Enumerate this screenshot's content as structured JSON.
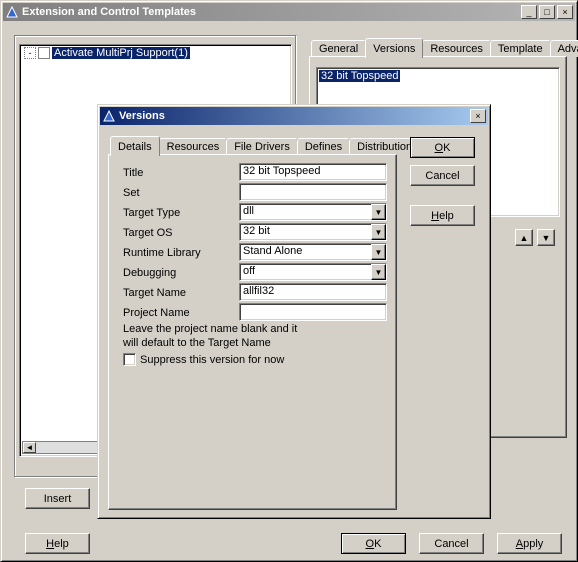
{
  "main_window": {
    "title": "Extension and Control Templates",
    "tree_item": "Activate MultiPrj Support(1)",
    "tabs": [
      "General",
      "Versions",
      "Resources",
      "Template",
      "Advanced"
    ],
    "active_tab": "Versions",
    "list_item": "32 bit Topspeed",
    "buttons": {
      "insert": "Insert",
      "help_letter": "H",
      "help_rest": "elp",
      "ok_letter": "O",
      "ok_rest": "K",
      "cancel": "Cancel",
      "apply_letter": "A",
      "apply_rest": "pply"
    }
  },
  "dialog": {
    "title": "Versions",
    "tabs": [
      "Details",
      "Resources",
      "File Drivers",
      "Defines",
      "Distribution"
    ],
    "active_tab": "Details",
    "fields": {
      "title_label": "Title",
      "title_value": "32 bit Topspeed",
      "set_label": "Set",
      "set_value": "",
      "target_type_label": "Target Type",
      "target_type_value": "dll",
      "target_os_label": "Target OS",
      "target_os_value": "32 bit",
      "runtime_label": "Runtime Library",
      "runtime_value": "Stand Alone",
      "debugging_label": "Debugging",
      "debugging_value": "off",
      "target_name_label": "Target Name",
      "target_name_value": "allfil32",
      "project_name_label": "Project Name",
      "project_name_value": ""
    },
    "hint1": "Leave the project name blank and it",
    "hint2": "will default to the Target Name",
    "checkbox_label": "Suppress this version for now",
    "buttons": {
      "ok_letter": "O",
      "ok_rest": "K",
      "cancel": "Cancel",
      "help_letter": "H",
      "help_rest": "elp"
    }
  }
}
